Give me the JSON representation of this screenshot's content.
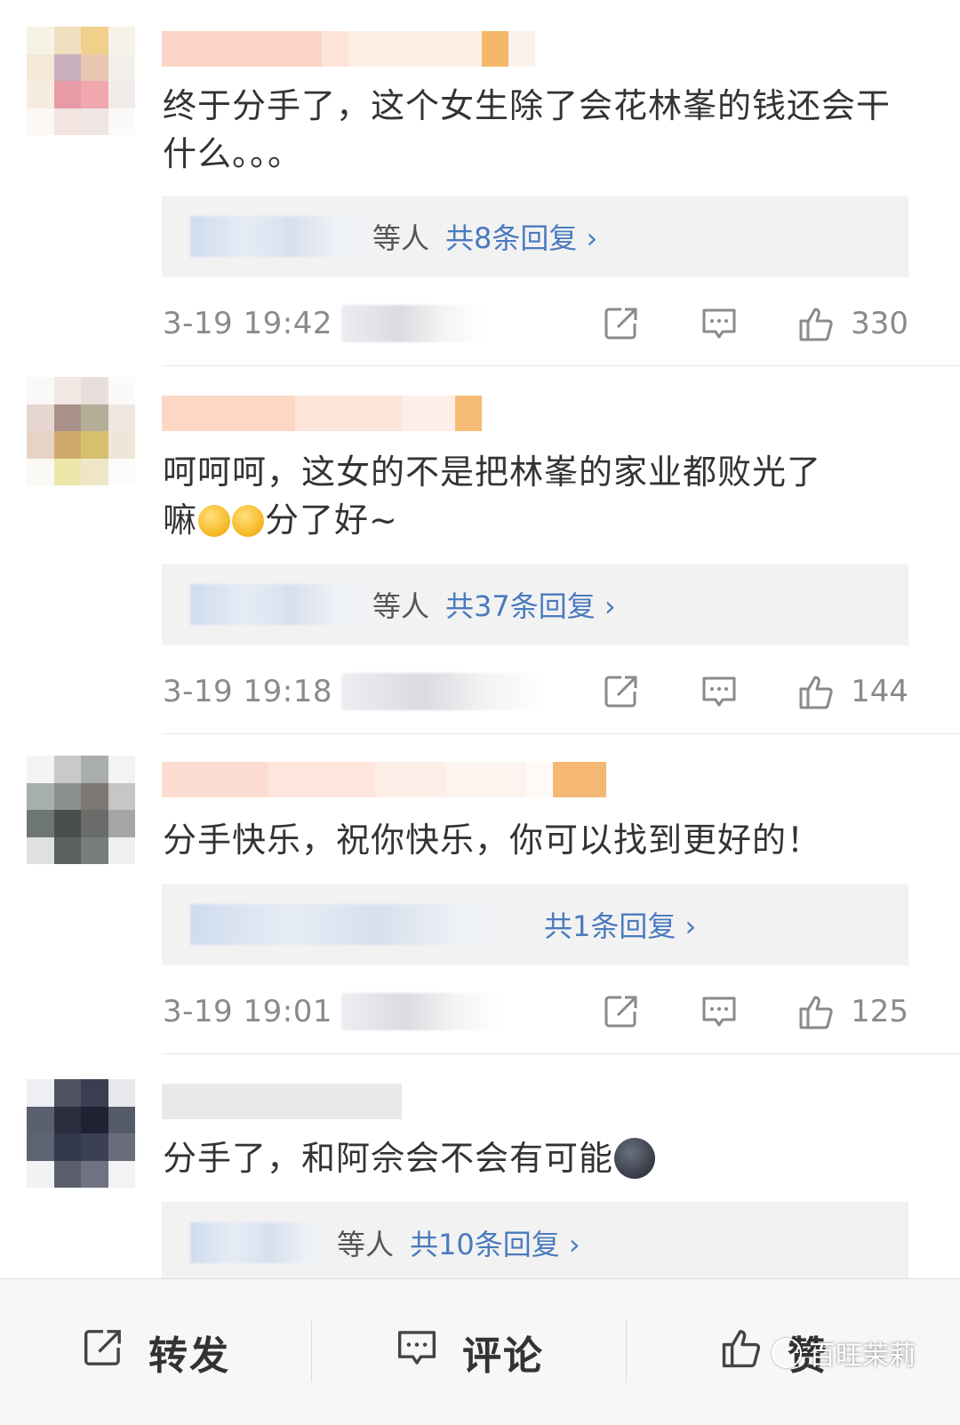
{
  "comments": [
    {
      "text": "终于分手了，这个女生除了会花林峯的钱还会干什么。。。",
      "reply_etc": "等人",
      "reply_count": "共8条回复 ›",
      "time": "3-19 19:42",
      "likes": "330"
    },
    {
      "text_a": "呵呵呵，这女的不是把林峯的家业都败光了",
      "text_b1": "嘛",
      "text_b2": "分了好~",
      "reply_etc": "等人",
      "reply_count": "共37条回复 ›",
      "time": "3-19 19:18",
      "likes": "144"
    },
    {
      "text": "分手快乐，祝你快乐，你可以找到更好的！",
      "reply_count": "共1条回复 ›",
      "time": "3-19 19:01",
      "likes": "125"
    },
    {
      "text": "分手了，和阿佘会不会有可能",
      "reply_etc": "等人",
      "reply_count": "共10条回复 ›"
    }
  ],
  "bottom_bar": {
    "repost": "转发",
    "comment": "评论",
    "like": "赞"
  },
  "watermark": "百旺茉莉",
  "icons": {
    "repost": "share-icon",
    "comment": "comment-icon",
    "like": "thumbs-up-icon"
  },
  "colors": {
    "link": "#4a7bbf",
    "meta": "#8a8a8a",
    "reply_bg": "#f2f2f2"
  }
}
